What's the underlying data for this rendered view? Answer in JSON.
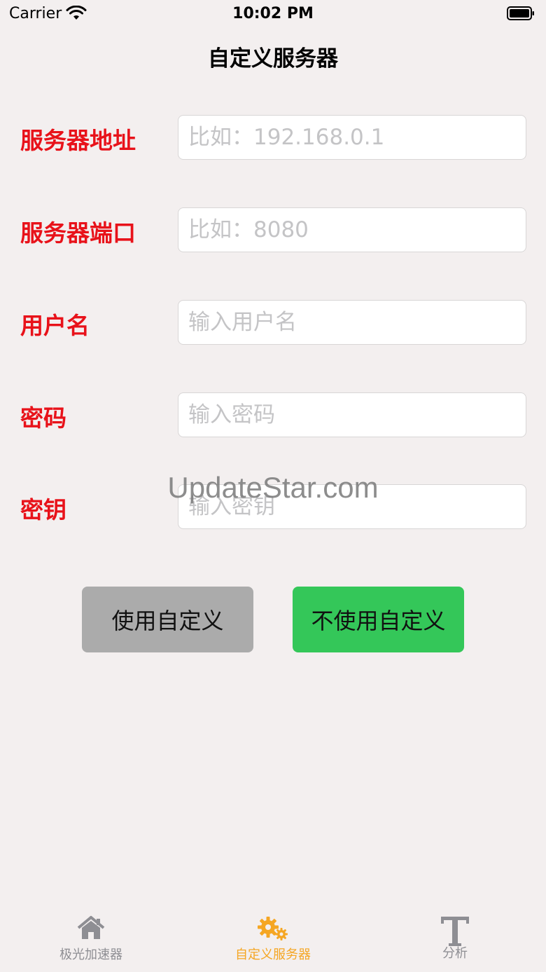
{
  "status_bar": {
    "carrier": "Carrier",
    "time": "10:02 PM"
  },
  "nav": {
    "title": "自定义服务器"
  },
  "form": {
    "rows": [
      {
        "label": "服务器地址",
        "placeholder": "比如：192.168.0.1",
        "value": ""
      },
      {
        "label": "服务器端口",
        "placeholder": "比如：8080",
        "value": ""
      },
      {
        "label": "用户名",
        "placeholder": "输入用户名",
        "value": ""
      },
      {
        "label": "密码",
        "placeholder": "输入密码",
        "value": ""
      },
      {
        "label": "密钥",
        "placeholder": "输入密钥",
        "value": ""
      }
    ]
  },
  "watermark": "UpdateStar.com",
  "buttons": {
    "use_custom": "使用自定义",
    "no_custom": "不使用自定义"
  },
  "tabs": [
    {
      "label": "极光加速器",
      "icon": "home-icon",
      "active": false
    },
    {
      "label": "自定义服务器",
      "icon": "gears-icon",
      "active": true
    },
    {
      "label": "分析",
      "icon": "text-t-icon",
      "active": false
    }
  ],
  "colors": {
    "background": "#f3efef",
    "label_red": "#e8121a",
    "button_gray": "#ababab",
    "button_green": "#34c759",
    "tab_active": "#f5a623",
    "tab_inactive": "#8e8e93"
  }
}
